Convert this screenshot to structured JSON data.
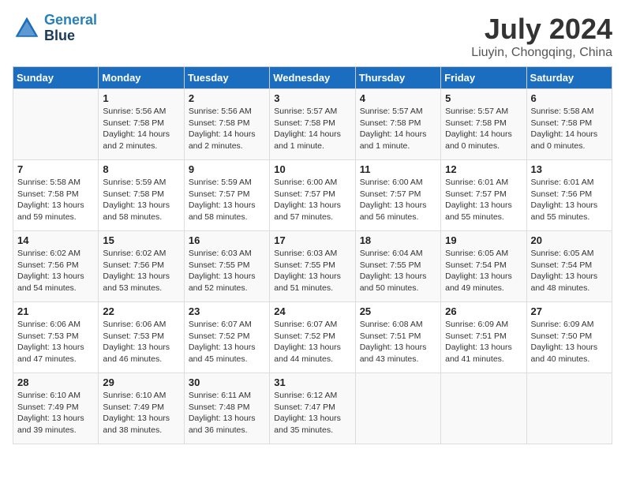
{
  "logo": {
    "line1": "General",
    "line2": "Blue"
  },
  "title": "July 2024",
  "subtitle": "Liuyin, Chongqing, China",
  "columns": [
    "Sunday",
    "Monday",
    "Tuesday",
    "Wednesday",
    "Thursday",
    "Friday",
    "Saturday"
  ],
  "weeks": [
    [
      {
        "day": "",
        "info": ""
      },
      {
        "day": "1",
        "info": "Sunrise: 5:56 AM\nSunset: 7:58 PM\nDaylight: 14 hours\nand 2 minutes."
      },
      {
        "day": "2",
        "info": "Sunrise: 5:56 AM\nSunset: 7:58 PM\nDaylight: 14 hours\nand 2 minutes."
      },
      {
        "day": "3",
        "info": "Sunrise: 5:57 AM\nSunset: 7:58 PM\nDaylight: 14 hours\nand 1 minute."
      },
      {
        "day": "4",
        "info": "Sunrise: 5:57 AM\nSunset: 7:58 PM\nDaylight: 14 hours\nand 1 minute."
      },
      {
        "day": "5",
        "info": "Sunrise: 5:57 AM\nSunset: 7:58 PM\nDaylight: 14 hours\nand 0 minutes."
      },
      {
        "day": "6",
        "info": "Sunrise: 5:58 AM\nSunset: 7:58 PM\nDaylight: 14 hours\nand 0 minutes."
      }
    ],
    [
      {
        "day": "7",
        "info": "Sunrise: 5:58 AM\nSunset: 7:58 PM\nDaylight: 13 hours\nand 59 minutes."
      },
      {
        "day": "8",
        "info": "Sunrise: 5:59 AM\nSunset: 7:58 PM\nDaylight: 13 hours\nand 58 minutes."
      },
      {
        "day": "9",
        "info": "Sunrise: 5:59 AM\nSunset: 7:57 PM\nDaylight: 13 hours\nand 58 minutes."
      },
      {
        "day": "10",
        "info": "Sunrise: 6:00 AM\nSunset: 7:57 PM\nDaylight: 13 hours\nand 57 minutes."
      },
      {
        "day": "11",
        "info": "Sunrise: 6:00 AM\nSunset: 7:57 PM\nDaylight: 13 hours\nand 56 minutes."
      },
      {
        "day": "12",
        "info": "Sunrise: 6:01 AM\nSunset: 7:57 PM\nDaylight: 13 hours\nand 55 minutes."
      },
      {
        "day": "13",
        "info": "Sunrise: 6:01 AM\nSunset: 7:56 PM\nDaylight: 13 hours\nand 55 minutes."
      }
    ],
    [
      {
        "day": "14",
        "info": "Sunrise: 6:02 AM\nSunset: 7:56 PM\nDaylight: 13 hours\nand 54 minutes."
      },
      {
        "day": "15",
        "info": "Sunrise: 6:02 AM\nSunset: 7:56 PM\nDaylight: 13 hours\nand 53 minutes."
      },
      {
        "day": "16",
        "info": "Sunrise: 6:03 AM\nSunset: 7:55 PM\nDaylight: 13 hours\nand 52 minutes."
      },
      {
        "day": "17",
        "info": "Sunrise: 6:03 AM\nSunset: 7:55 PM\nDaylight: 13 hours\nand 51 minutes."
      },
      {
        "day": "18",
        "info": "Sunrise: 6:04 AM\nSunset: 7:55 PM\nDaylight: 13 hours\nand 50 minutes."
      },
      {
        "day": "19",
        "info": "Sunrise: 6:05 AM\nSunset: 7:54 PM\nDaylight: 13 hours\nand 49 minutes."
      },
      {
        "day": "20",
        "info": "Sunrise: 6:05 AM\nSunset: 7:54 PM\nDaylight: 13 hours\nand 48 minutes."
      }
    ],
    [
      {
        "day": "21",
        "info": "Sunrise: 6:06 AM\nSunset: 7:53 PM\nDaylight: 13 hours\nand 47 minutes."
      },
      {
        "day": "22",
        "info": "Sunrise: 6:06 AM\nSunset: 7:53 PM\nDaylight: 13 hours\nand 46 minutes."
      },
      {
        "day": "23",
        "info": "Sunrise: 6:07 AM\nSunset: 7:52 PM\nDaylight: 13 hours\nand 45 minutes."
      },
      {
        "day": "24",
        "info": "Sunrise: 6:07 AM\nSunset: 7:52 PM\nDaylight: 13 hours\nand 44 minutes."
      },
      {
        "day": "25",
        "info": "Sunrise: 6:08 AM\nSunset: 7:51 PM\nDaylight: 13 hours\nand 43 minutes."
      },
      {
        "day": "26",
        "info": "Sunrise: 6:09 AM\nSunset: 7:51 PM\nDaylight: 13 hours\nand 41 minutes."
      },
      {
        "day": "27",
        "info": "Sunrise: 6:09 AM\nSunset: 7:50 PM\nDaylight: 13 hours\nand 40 minutes."
      }
    ],
    [
      {
        "day": "28",
        "info": "Sunrise: 6:10 AM\nSunset: 7:49 PM\nDaylight: 13 hours\nand 39 minutes."
      },
      {
        "day": "29",
        "info": "Sunrise: 6:10 AM\nSunset: 7:49 PM\nDaylight: 13 hours\nand 38 minutes."
      },
      {
        "day": "30",
        "info": "Sunrise: 6:11 AM\nSunset: 7:48 PM\nDaylight: 13 hours\nand 36 minutes."
      },
      {
        "day": "31",
        "info": "Sunrise: 6:12 AM\nSunset: 7:47 PM\nDaylight: 13 hours\nand 35 minutes."
      },
      {
        "day": "",
        "info": ""
      },
      {
        "day": "",
        "info": ""
      },
      {
        "day": "",
        "info": ""
      }
    ]
  ]
}
